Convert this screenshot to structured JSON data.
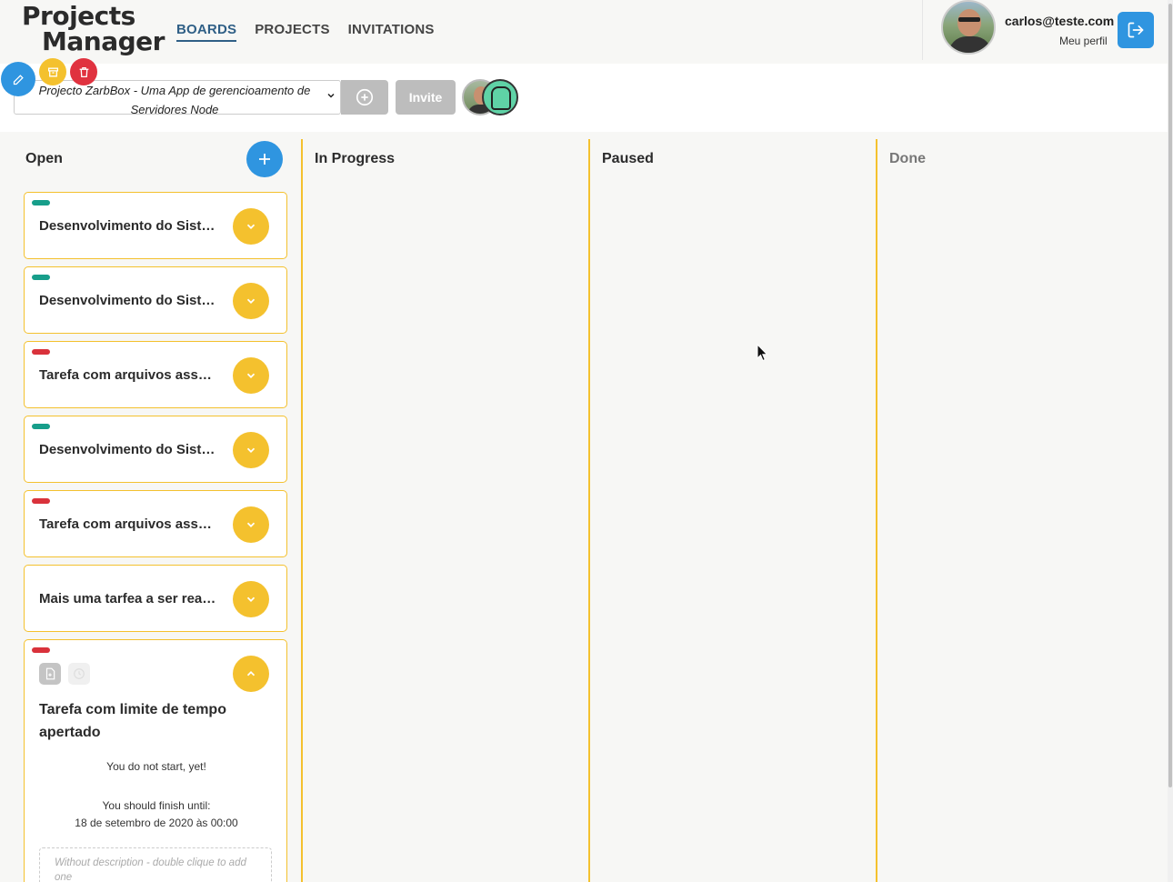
{
  "app": {
    "logo_line1": "Projects",
    "logo_line2": "Manager"
  },
  "nav": {
    "boards": "BOARDS",
    "projects": "PROJECTS",
    "invitations": "INVITATIONS"
  },
  "user": {
    "email": "carlos@teste.com",
    "profile_link": "Meu perfil"
  },
  "toolbar": {
    "selected_project": "Projecto ZarbBox - Uma App de gerencioamento de Servidores Node",
    "invite_label": "Invite"
  },
  "columns": {
    "open": "Open",
    "in_progress": "In Progress",
    "paused": "Paused",
    "done": "Done"
  },
  "cards": [
    {
      "title": "Desenvolvimento do Sistema de Gerenciamento",
      "tag": "green"
    },
    {
      "title": "Desenvolvimento do Sistema de Gerenciamento",
      "tag": "green"
    },
    {
      "title": "Tarefa com arquivos associados",
      "tag": "red"
    },
    {
      "title": "Desenvolvimento do Sistema de Gerenciamento",
      "tag": "green"
    },
    {
      "title": "Tarefa com arquivos associados",
      "tag": "red"
    },
    {
      "title": "Mais uma tarfea a ser realizada",
      "tag": "none"
    }
  ],
  "expanded_card": {
    "title": "Tarefa com limite de tempo apertado",
    "tag": "red",
    "start_status": "You do not start, yet!",
    "deadline_label": "You should finish until:",
    "deadline_value": "18 de setembro de 2020 às 00:00",
    "description_placeholder": "Without description - double clique to add one"
  },
  "colors": {
    "primary": "#2f95e0",
    "accent": "#f4c12e",
    "danger": "#e0323f",
    "tag_green": "#179e8a",
    "tag_red": "#d9323b"
  }
}
